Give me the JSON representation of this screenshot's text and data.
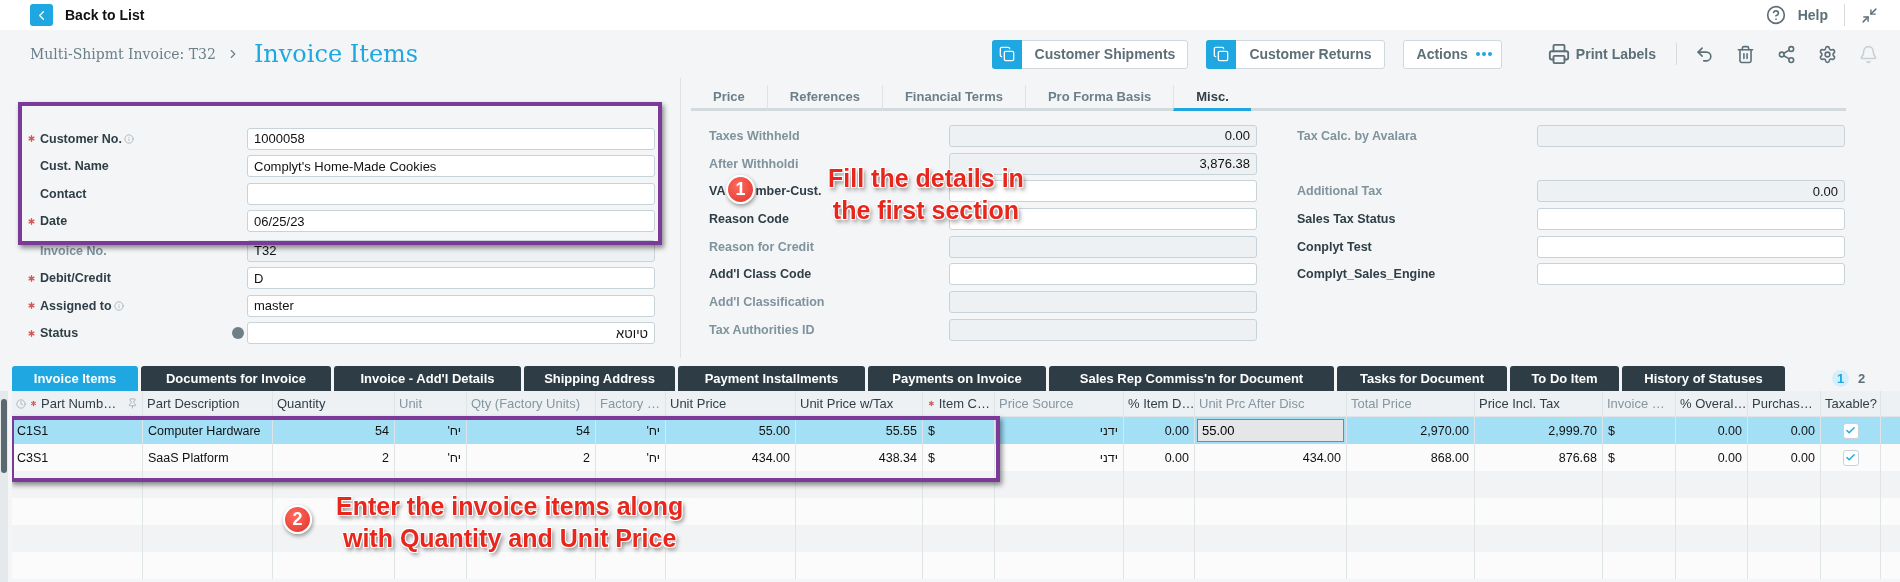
{
  "top_bar": {
    "back_label": "Back to List",
    "help_label": "Help"
  },
  "header": {
    "breadcrumb": "Multi-Shipmt Invoice: T32",
    "title": "Invoice Items",
    "buttons": [
      {
        "kind": "linked",
        "label": "Customer Shipments"
      },
      {
        "kind": "linked",
        "label": "Customer Returns"
      },
      {
        "kind": "menu",
        "label": "Actions"
      }
    ],
    "print_label": "Print Labels",
    "notifications_disabled": true
  },
  "form": {
    "groups": [
      {
        "highlighted": true,
        "fields": [
          {
            "kind": "text",
            "label": "Customer No.",
            "value": "1000058",
            "required": true,
            "info": true,
            "disabled": false
          },
          {
            "kind": "text",
            "label": "Cust. Name",
            "value": "Complyt's Home-Made Cookies",
            "required": false,
            "info": false,
            "disabled": false
          },
          {
            "kind": "text",
            "label": "Contact",
            "required": false,
            "info": false,
            "disabled": false
          },
          {
            "kind": "text",
            "label": "Date",
            "value": "06/25/23",
            "required": true,
            "info": false,
            "disabled": false
          }
        ]
      },
      {
        "highlighted": false,
        "fields": [
          {
            "kind": "text",
            "label": "Invoice No.",
            "value": "T32",
            "required": false,
            "info": false,
            "disabled": true
          },
          {
            "kind": "text",
            "label": "Debit/Credit",
            "value": "D",
            "required": true,
            "info": false,
            "disabled": false
          },
          {
            "kind": "text",
            "label": "Assigned to",
            "value": "master",
            "required": true,
            "info": true,
            "disabled": false
          },
          {
            "kind": "status",
            "label": "Status",
            "value": "טיוטא",
            "required": true,
            "info": false,
            "disabled": false
          }
        ]
      }
    ]
  },
  "details": {
    "tabs": [
      {
        "label": "Price",
        "selected": false
      },
      {
        "label": "References",
        "selected": false
      },
      {
        "label": "Financial Terms",
        "selected": false
      },
      {
        "label": "Pro Forma Basis",
        "selected": false
      },
      {
        "label": "Misc.",
        "selected": true
      }
    ],
    "columns": [
      [
        {
          "kind": "number",
          "label": "Taxes Withheld",
          "value": "0.00",
          "disabled": true
        },
        {
          "kind": "number",
          "label": "After Withholdi",
          "value": "3,876.38",
          "disabled": true
        },
        {
          "kind": "text",
          "label": "VA",
          "label_tail": "mber-Cust.",
          "disabled": false
        },
        {
          "kind": "text",
          "label": "Reason Code",
          "disabled": false
        },
        {
          "kind": "text",
          "label": "Reason for Credit",
          "disabled": true
        },
        {
          "kind": "text",
          "label": "Add'l Class Code",
          "disabled": false
        },
        {
          "kind": "text",
          "label": "Add'l Classification",
          "disabled": true
        },
        {
          "kind": "text",
          "label": "Tax Authorities ID",
          "disabled": true
        }
      ],
      [
        {
          "kind": "text",
          "label": "Tax Calc. by Avalara",
          "disabled": true
        },
        {
          "kind": "gap"
        },
        {
          "kind": "number",
          "label": "Additional Tax",
          "value": "0.00",
          "disabled": true
        },
        {
          "kind": "text",
          "label": "Sales Tax Status",
          "disabled": false
        },
        {
          "kind": "text",
          "label": "Conplyt Test",
          "disabled": false
        },
        {
          "kind": "text",
          "label": "Complyt_Sales_Engine",
          "disabled": false
        }
      ]
    ]
  },
  "table": {
    "tabs": [
      {
        "label": "Invoice Items",
        "selected": true
      },
      {
        "label": "Documents for Invoice",
        "selected": false
      },
      {
        "label": "Invoice - Add'l Details",
        "selected": false
      },
      {
        "label": "Shipping Address",
        "selected": false
      },
      {
        "label": "Payment Installments",
        "selected": false
      },
      {
        "label": "Payments on Invoice",
        "selected": false
      },
      {
        "label": "Sales Rep Commiss'n for Document",
        "selected": false
      },
      {
        "label": "Tasks for Document",
        "selected": false
      },
      {
        "label": "To Do Item",
        "selected": false
      },
      {
        "label": "History of Statuses",
        "selected": false
      }
    ],
    "pages": [
      {
        "label": "1",
        "selected": true
      },
      {
        "label": "2",
        "selected": false
      }
    ],
    "highlighted": true,
    "columns": [
      {
        "label": "Part Numb…",
        "kind": "text",
        "dimmed": false,
        "required": true,
        "pinned": true
      },
      {
        "label": "Part Description",
        "kind": "text",
        "dimmed": false,
        "required": false,
        "pinned": false
      },
      {
        "label": "Quantity",
        "kind": "number",
        "dimmed": false,
        "required": false,
        "pinned": false
      },
      {
        "label": "Unit",
        "kind": "hebrew",
        "dimmed": true,
        "required": false,
        "pinned": false
      },
      {
        "label": "Qty (Factory Units)",
        "kind": "number",
        "dimmed": true,
        "required": false,
        "pinned": false
      },
      {
        "label": "Factory …",
        "kind": "hebrew",
        "dimmed": true,
        "required": false,
        "pinned": false
      },
      {
        "label": "Unit Price",
        "kind": "number",
        "dimmed": false,
        "required": false,
        "pinned": false
      },
      {
        "label": "Unit Price w/Tax",
        "kind": "number",
        "dimmed": false,
        "required": false,
        "pinned": false
      },
      {
        "label": "Item C…",
        "kind": "text",
        "dimmed": false,
        "required": true,
        "pinned": false
      },
      {
        "label": "Price Source",
        "kind": "hebrew",
        "dimmed": true,
        "required": false,
        "pinned": false
      },
      {
        "label": "% Item D…",
        "kind": "number",
        "dimmed": false,
        "required": false,
        "pinned": false
      },
      {
        "label": "Unit Prc After Disc",
        "kind": "number",
        "dimmed": true,
        "required": false,
        "pinned": false
      },
      {
        "label": "Total Price",
        "kind": "number",
        "dimmed": true,
        "required": false,
        "pinned": false
      },
      {
        "label": "Price Incl. Tax",
        "kind": "number",
        "dimmed": false,
        "required": false,
        "pinned": false
      },
      {
        "label": "Invoice …",
        "kind": "text",
        "dimmed": true,
        "required": false,
        "pinned": false
      },
      {
        "label": "% Overal…",
        "kind": "number",
        "dimmed": false,
        "required": false,
        "pinned": false
      },
      {
        "label": "Purchas…",
        "kind": "number",
        "dimmed": false,
        "required": false,
        "pinned": false
      },
      {
        "label": "Taxable?",
        "kind": "check",
        "dimmed": false,
        "required": false,
        "pinned": false
      }
    ],
    "rows": [
      {
        "selected": true,
        "editor": {
          "value": "55.00"
        },
        "taxable": true,
        "cells": [
          "C1S1",
          "Computer Hardware",
          "54",
          "יח'",
          "54",
          "יח'",
          "55.00",
          "55.55",
          "$",
          "ידני",
          "0.00",
          null,
          "2,970.00",
          "2,999.70",
          "$",
          "0.00",
          "0.00"
        ]
      },
      {
        "selected": false,
        "taxable": true,
        "cells": [
          "C3S1",
          "SaaS Platform",
          "2",
          "יח'",
          "2",
          "יח'",
          "434.00",
          "438.34",
          "$",
          "ידני",
          "0.00",
          "434.00",
          "868.00",
          "876.68",
          "$",
          "0.00",
          "0.00"
        ]
      }
    ]
  },
  "annotations": [
    {
      "number": "1",
      "text": "Fill the details in\nthe first section"
    },
    {
      "number": "2",
      "text": "Enter the invoice items along\nwith Quantity and Unit Price"
    }
  ]
}
